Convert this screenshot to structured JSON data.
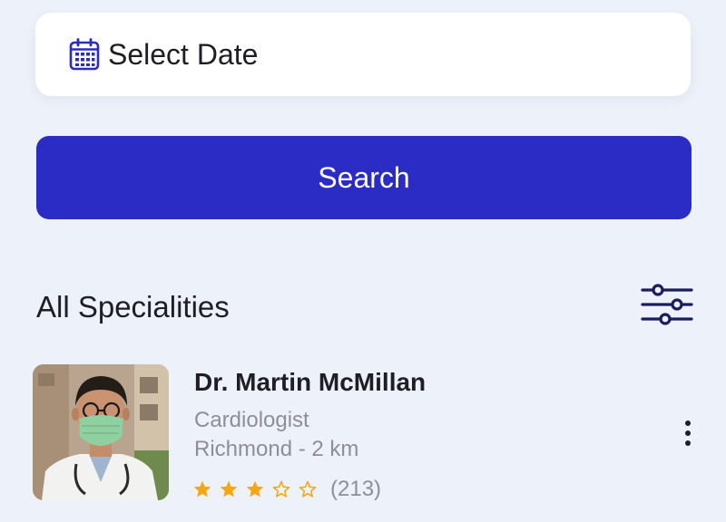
{
  "date_picker": {
    "label": "Select Date",
    "icon": "calendar-icon"
  },
  "search_button": {
    "label": "Search"
  },
  "section": {
    "title": "All Specialities",
    "filter_icon": "sliders-icon"
  },
  "doctors": [
    {
      "name": "Dr. Martin McMillan",
      "specialty": "Cardiologist",
      "location": "Richmond - 2 km",
      "rating": 3,
      "rating_max": 5,
      "reviews": "(213)",
      "menu_icon": "more-vertical-icon"
    }
  ],
  "colors": {
    "background": "#edf1f9",
    "accent": "#2b2bc5",
    "icon_dark": "#1c1c5e",
    "star": "#f6a610",
    "text_secondary": "#8d8f98"
  }
}
